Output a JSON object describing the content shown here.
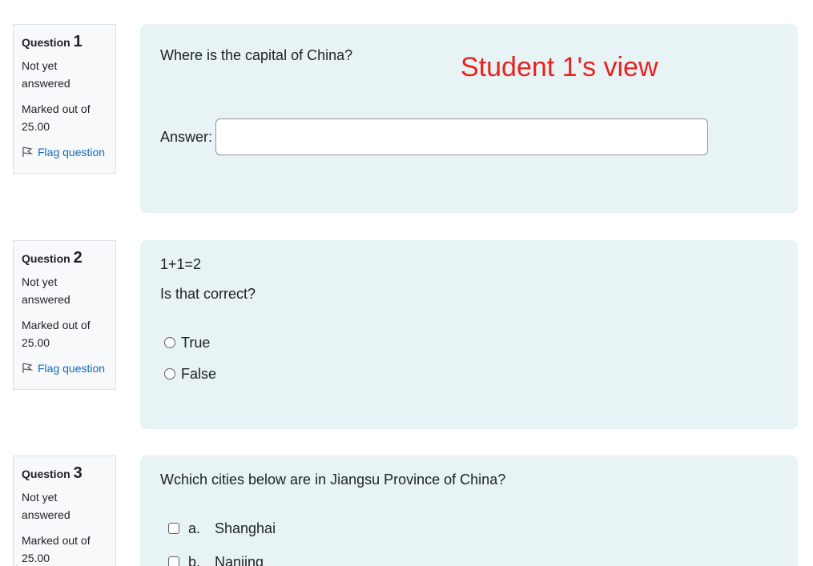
{
  "watermark": "Student 1's view",
  "questions": [
    {
      "title_prefix": "Question",
      "number": "1",
      "status": "Not yet answered",
      "marks": "Marked out of 25.00",
      "flag_label": "Flag question",
      "text": "Where is the capital of China?",
      "answer_label": "Answer:",
      "answer_value": ""
    },
    {
      "title_prefix": "Question",
      "number": "2",
      "status": "Not yet answered",
      "marks": "Marked out of 25.00",
      "flag_label": "Flag question",
      "text": "1+1=2",
      "prompt": "Is that correct?",
      "options": [
        "True",
        "False"
      ]
    },
    {
      "title_prefix": "Question",
      "number": "3",
      "status": "Not yet answered",
      "marks": "Marked out of 25.00",
      "text": "Wchich cities below are in Jiangsu Province of China?",
      "options": [
        {
          "letter": "a.",
          "label": "Shanghai"
        },
        {
          "letter": "b.",
          "label": "Nanjing"
        }
      ]
    }
  ]
}
